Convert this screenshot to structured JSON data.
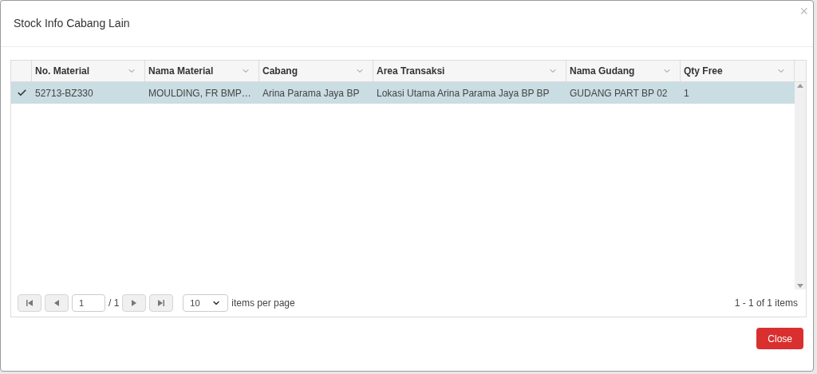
{
  "dialog": {
    "title": "Stock Info Cabang Lain",
    "close_icon": "×"
  },
  "table": {
    "columns": [
      "No. Material",
      "Nama Material",
      "Cabang",
      "Area Transaksi",
      "Nama Gudang",
      "Qty Free"
    ],
    "rows": [
      {
        "selected": true,
        "cells": [
          "52713-BZ330",
          "MOULDING, FR BMP…",
          "Arina Parama Jaya BP",
          "Lokasi Utama Arina Parama Jaya BP BP",
          "GUDANG PART BP 02",
          "1"
        ]
      }
    ]
  },
  "pager": {
    "page": "1",
    "of_pages": "/ 1",
    "page_size": "10",
    "page_size_label": "items per page",
    "summary": "1 - 1 of 1 items"
  },
  "buttons": [
    "Close"
  ]
}
